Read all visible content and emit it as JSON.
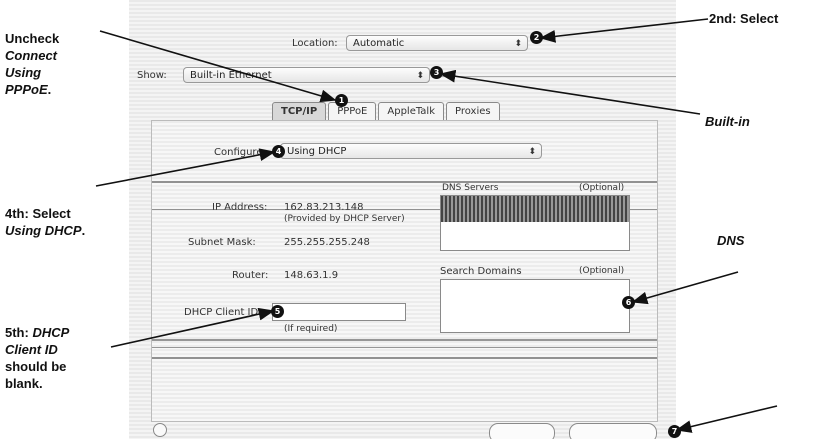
{
  "annotations": {
    "uncheck_l1": "Uncheck",
    "uncheck_l2": "Connect",
    "uncheck_l3": "Using",
    "uncheck_l4": "PPPoE",
    "uncheck_l4_tail": ".",
    "second": "2nd: Select",
    "builtin": "Built-in",
    "fourth_l1": "4th: Select",
    "fourth_l2": "Using DHCP",
    "fourth_l2_tail": ".",
    "dns": "DNS",
    "fifth_l1_a": "5th: ",
    "fifth_l1_b": "DHCP",
    "fifth_l2": "Client ID",
    "fifth_l3": "should be",
    "fifth_l4": "blank."
  },
  "window": {
    "location_label": "Location:",
    "location_value": "Automatic",
    "show_label": "Show:",
    "show_value": "Built-in Ethernet",
    "tabs": [
      "TCP/IP",
      "PPPoE",
      "AppleTalk",
      "Proxies"
    ],
    "configure_label": "Configure",
    "configure_value": "Using DHCP",
    "ip_label": "IP Address:",
    "ip_value": "162.83.213.148",
    "ip_note": "(Provided by DHCP Server)",
    "dns_servers_label": "DNS Servers",
    "dns_servers_optional": "(Optional)",
    "subnet_label": "Subnet Mask:",
    "subnet_value": "255.255.255.248",
    "router_label": "Router:",
    "router_value": "148.63.1.9",
    "search_domains_label": "Search Domains",
    "search_domains_optional": "(Optional)",
    "dhcp_label": "DHCP Client ID:",
    "dhcp_hint": "(If required)"
  },
  "markers": [
    "1",
    "2",
    "3",
    "4",
    "5",
    "6",
    "7"
  ],
  "icons": [
    "popup-arrow-icon",
    "help-icon"
  ]
}
